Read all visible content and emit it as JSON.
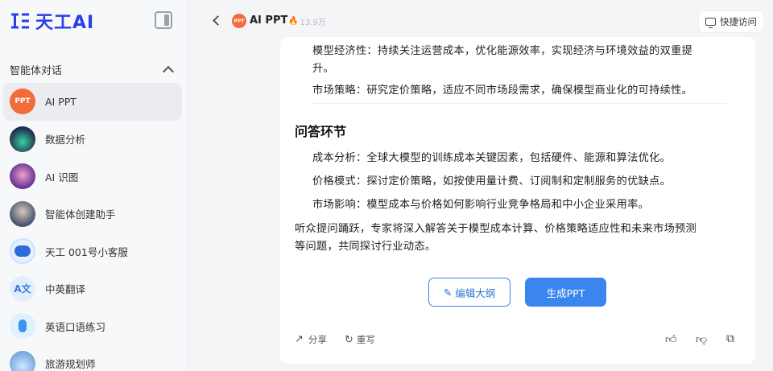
{
  "app": {
    "name": "天工AI"
  },
  "sidebar": {
    "section_title": "智能体对话",
    "items": [
      {
        "label": "AI PPT",
        "avatar_text": "PPT"
      },
      {
        "label": "数据分析"
      },
      {
        "label": "AI 识图"
      },
      {
        "label": "智能体创建助手"
      },
      {
        "label": "天工 001号小客服"
      },
      {
        "label": "中英翻译",
        "avatar_text": "A文"
      },
      {
        "label": "英语口语练习"
      },
      {
        "label": "旅游规划师"
      }
    ]
  },
  "header": {
    "title": "AI PPT",
    "icon_text": "PPT",
    "hot_count": "13.9万",
    "quick_access": "快捷访问"
  },
  "content": {
    "line1": "模型经济性：持续关注运营成本，优化能源效率，实现经济与环境效益的双重提",
    "line1b": "升。",
    "line2": "市场策略：研究定价策略，适应不同市场段需求，确保模型商业化的可持续性。",
    "section_title": "问答环节",
    "qa": [
      "成本分析：全球大模型的训练成本关键因素，包括硬件、能源和算法优化。",
      "价格模式：探讨定价策略，如按使用量计费、订阅制和定制服务的优缺点。",
      "市场影响：模型成本与价格如何影响行业竞争格局和中小企业采用率。"
    ],
    "summary1": "听众提问踊跃，专家将深入解答关于模型成本计算、价格策略适应性和未来市场预测",
    "summary2": "等问题，共同探讨行业动态。"
  },
  "actions": {
    "edit_outline": "编辑大纲",
    "generate_ppt": "生成PPT",
    "share": "分享",
    "rewrite": "重写"
  },
  "colors": {
    "brand": "#2a3cf0",
    "primary": "#3b86ee",
    "ppt_orange": "#f26b3a"
  }
}
